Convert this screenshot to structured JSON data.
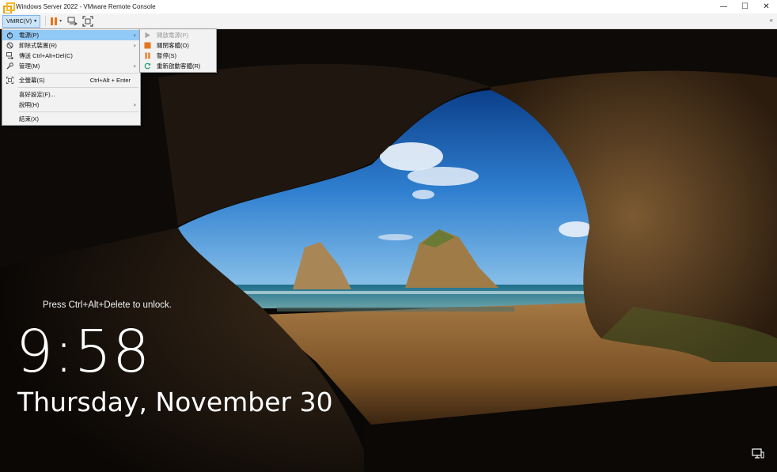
{
  "window": {
    "title": "Windows Server 2022 - VMware Remote Console",
    "minimize": "—",
    "maximize": "☐",
    "close": "✕"
  },
  "toolbar": {
    "vmrc_label": "VMRC(V)",
    "dropdown_caret": "▾",
    "collapse": "«"
  },
  "main_menu": {
    "items": [
      {
        "label": "電源(P)",
        "icon": "power-icon",
        "has_submenu": true,
        "active": true
      },
      {
        "label": "卸除式裝置(R)",
        "icon": "removable-device-icon",
        "has_submenu": true
      },
      {
        "label": "傳送 Ctrl+Alt+Del(C)",
        "icon": "ctrl-alt-del-icon"
      },
      {
        "label": "管理(M)",
        "icon": "wrench-icon",
        "has_submenu": true
      },
      {
        "label": "全螢幕(S)",
        "icon": "fullscreen-icon",
        "shortcut": "Ctrl+Alt + Enter"
      },
      {
        "label": "喜好設定(F)..."
      },
      {
        "label": "說明(H)",
        "has_submenu": true
      },
      {
        "label": "結束(X)"
      }
    ]
  },
  "power_submenu": {
    "items": [
      {
        "label": "開啟電源(P)",
        "icon": "play-icon",
        "disabled": true
      },
      {
        "label": "關閉客體(O)",
        "icon": "stop-icon"
      },
      {
        "label": "暫停(S)",
        "icon": "pause-icon"
      },
      {
        "label": "重新啟動客體(R)",
        "icon": "restart-icon"
      }
    ]
  },
  "lockscreen": {
    "unlock_hint": "Press Ctrl+Alt+Delete to unlock.",
    "time": "9:58",
    "date": "Thursday, November 30"
  },
  "colors": {
    "accent_orange": "#e4761c",
    "menu_highlight": "#91c9f7",
    "toolbar_button_bg": "#cce4f7"
  }
}
